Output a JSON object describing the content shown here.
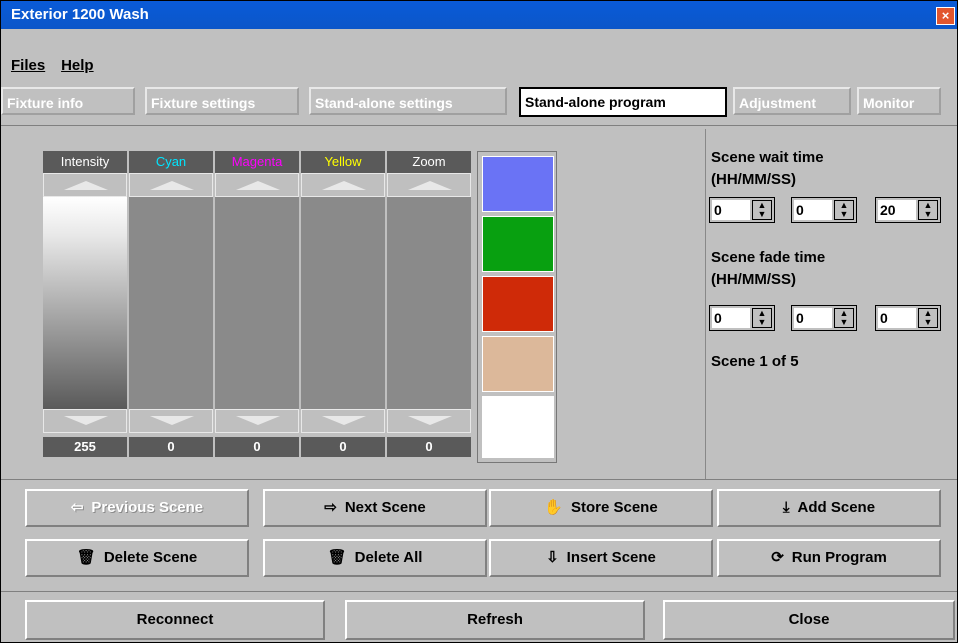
{
  "window": {
    "title": "Exterior 1200 Wash",
    "close_glyph": "×"
  },
  "menu": {
    "files": "Files",
    "help": "Help"
  },
  "tabs": [
    {
      "label": "Fixture info"
    },
    {
      "label": "Fixture settings"
    },
    {
      "label": "Stand-alone settings"
    },
    {
      "label": "Stand-alone program",
      "active": true
    },
    {
      "label": "Adjustment"
    },
    {
      "label": "Monitor"
    }
  ],
  "faders": [
    {
      "label": "Intensity",
      "label_color": "#ffffff",
      "value": "255",
      "lit": true
    },
    {
      "label": "Cyan",
      "label_color": "#00e5ff",
      "value": "0",
      "lit": false
    },
    {
      "label": "Magenta",
      "label_color": "#ff00ff",
      "value": "0",
      "lit": false
    },
    {
      "label": "Yellow",
      "label_color": "#ffff00",
      "value": "0",
      "lit": false
    },
    {
      "label": "Zoom",
      "label_color": "#ffffff",
      "value": "0",
      "lit": false
    }
  ],
  "swatch_colors": [
    "#6a73f5",
    "#08a010",
    "#cf2a08",
    "#dcb89a",
    "#ffffff"
  ],
  "scene": {
    "wait_label": "Scene wait time",
    "wait_format": "(HH/MM/SS)",
    "wait_values": [
      "0",
      "0",
      "20"
    ],
    "fade_label": "Scene fade time",
    "fade_format": "(HH/MM/SS)",
    "fade_values": [
      "0",
      "0",
      "0"
    ],
    "counter": "Scene 1 of 5"
  },
  "buttons": {
    "previous_scene": "Previous Scene",
    "next_scene": "Next Scene",
    "store_scene": "Store Scene",
    "add_scene": "Add Scene",
    "delete_scene": "Delete Scene",
    "delete_all": "Delete All",
    "insert_scene": "Insert Scene",
    "run_program": "Run Program"
  },
  "footer": {
    "reconnect": "Reconnect",
    "refresh": "Refresh",
    "close": "Close"
  },
  "icons": {
    "prev": "⇦",
    "next": "⇨",
    "store": "✋",
    "add": "⤓",
    "delete": "🗑",
    "delete_all": "🗑",
    "insert": "⇩",
    "run": "⟳"
  }
}
